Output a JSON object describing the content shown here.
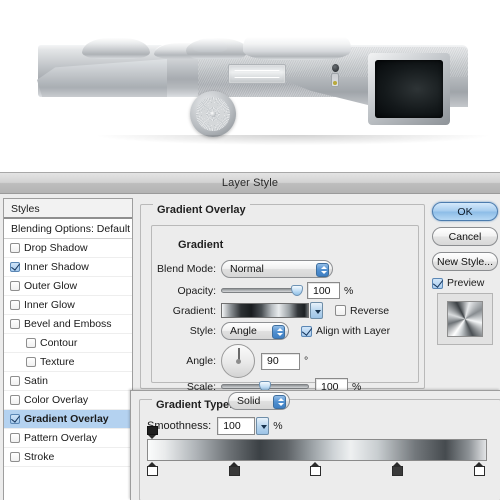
{
  "window": {
    "title": "Layer Style"
  },
  "photo": {
    "alt_name": "digital-camera-top-plate-photo",
    "description": "Silver compact camera top plate with dials, shutter ring, engraved panel, port, LED and a dark viewfinder window with green glow"
  },
  "styles_panel": {
    "header": "Styles",
    "blending_options": "Blending Options: Default",
    "items": [
      {
        "label": "Drop Shadow",
        "checked": false,
        "sub": false
      },
      {
        "label": "Inner Shadow",
        "checked": true,
        "sub": false
      },
      {
        "label": "Outer Glow",
        "checked": false,
        "sub": false
      },
      {
        "label": "Inner Glow",
        "checked": false,
        "sub": false
      },
      {
        "label": "Bevel and Emboss",
        "checked": false,
        "sub": false
      },
      {
        "label": "Contour",
        "checked": false,
        "sub": true
      },
      {
        "label": "Texture",
        "checked": false,
        "sub": true
      },
      {
        "label": "Satin",
        "checked": false,
        "sub": false
      },
      {
        "label": "Color Overlay",
        "checked": false,
        "sub": false
      },
      {
        "label": "Gradient Overlay",
        "checked": true,
        "sub": false,
        "selected": true
      },
      {
        "label": "Pattern Overlay",
        "checked": false,
        "sub": false
      },
      {
        "label": "Stroke",
        "checked": false,
        "sub": false
      }
    ]
  },
  "gradient_overlay": {
    "section_title": "Gradient Overlay",
    "subsection_title": "Gradient",
    "blend_mode": {
      "label": "Blend Mode:",
      "value": "Normal"
    },
    "opacity": {
      "label": "Opacity:",
      "value": "100",
      "unit": "%",
      "percent": 100
    },
    "gradient": {
      "label": "Gradient:",
      "swatch_name": "gradient-preview-swatch"
    },
    "reverse": {
      "label": "Reverse",
      "checked": false
    },
    "style": {
      "label": "Style:",
      "value": "Angle"
    },
    "align_with_layer": {
      "label": "Align with Layer",
      "checked": true
    },
    "angle": {
      "label": "Angle:",
      "value": "90",
      "unit": "°",
      "degrees": 90
    },
    "scale": {
      "label": "Scale:",
      "value": "100",
      "unit": "%",
      "percent": 45
    }
  },
  "gradient_editor": {
    "section_title": "Gradient Type:",
    "gradient_type": "Solid",
    "smoothness": {
      "label": "Smoothness:",
      "value": "100",
      "unit": "%"
    },
    "opacity_stops": [
      {
        "position": 0
      }
    ],
    "color_stops": [
      {
        "position": 0,
        "shade": "light"
      },
      {
        "position": 24,
        "shade": "dark"
      },
      {
        "position": 48,
        "shade": "light"
      },
      {
        "position": 72,
        "shade": "dark"
      },
      {
        "position": 96,
        "shade": "light"
      }
    ]
  },
  "buttons": {
    "ok": "OK",
    "cancel": "Cancel",
    "new_style": "New Style...",
    "preview": {
      "label": "Preview",
      "checked": true
    }
  },
  "colors": {
    "dialog_bg": "#ececec",
    "titlebar": "#c6c6c6",
    "selection_blue": "#b4d2f0",
    "accent_blue": "#4f8fd0",
    "field_white": "#ffffff",
    "group_border": "#b9b9b9",
    "finder_glow_green": "#9fd9ad"
  }
}
